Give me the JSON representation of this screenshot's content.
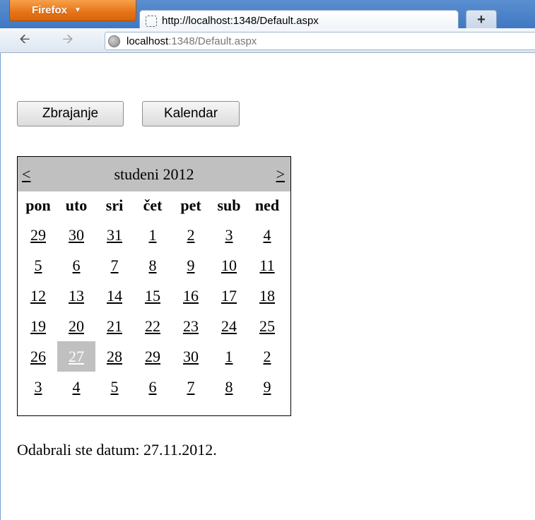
{
  "browser": {
    "app_button": "Firefox",
    "tab_title": "http://localhost:1348/Default.aspx",
    "new_tab_label": "+",
    "url_host": "localhost",
    "url_rest": ":1348/Default.aspx"
  },
  "buttons": {
    "zbrajanje": "Zbrajanje",
    "kalendar": "Kalendar"
  },
  "calendar": {
    "prev": "<",
    "next": ">",
    "title": "studeni 2012",
    "day_names": [
      "pon",
      "uto",
      "sri",
      "čet",
      "pet",
      "sub",
      "ned"
    ],
    "weeks": [
      [
        "29",
        "30",
        "31",
        "1",
        "2",
        "3",
        "4"
      ],
      [
        "5",
        "6",
        "7",
        "8",
        "9",
        "10",
        "11"
      ],
      [
        "12",
        "13",
        "14",
        "15",
        "16",
        "17",
        "18"
      ],
      [
        "19",
        "20",
        "21",
        "22",
        "23",
        "24",
        "25"
      ],
      [
        "26",
        "27",
        "28",
        "29",
        "30",
        "1",
        "2"
      ],
      [
        "3",
        "4",
        "5",
        "6",
        "7",
        "8",
        "9"
      ]
    ],
    "selected": "27"
  },
  "result_text": "Odabrali ste datum: 27.11.2012."
}
